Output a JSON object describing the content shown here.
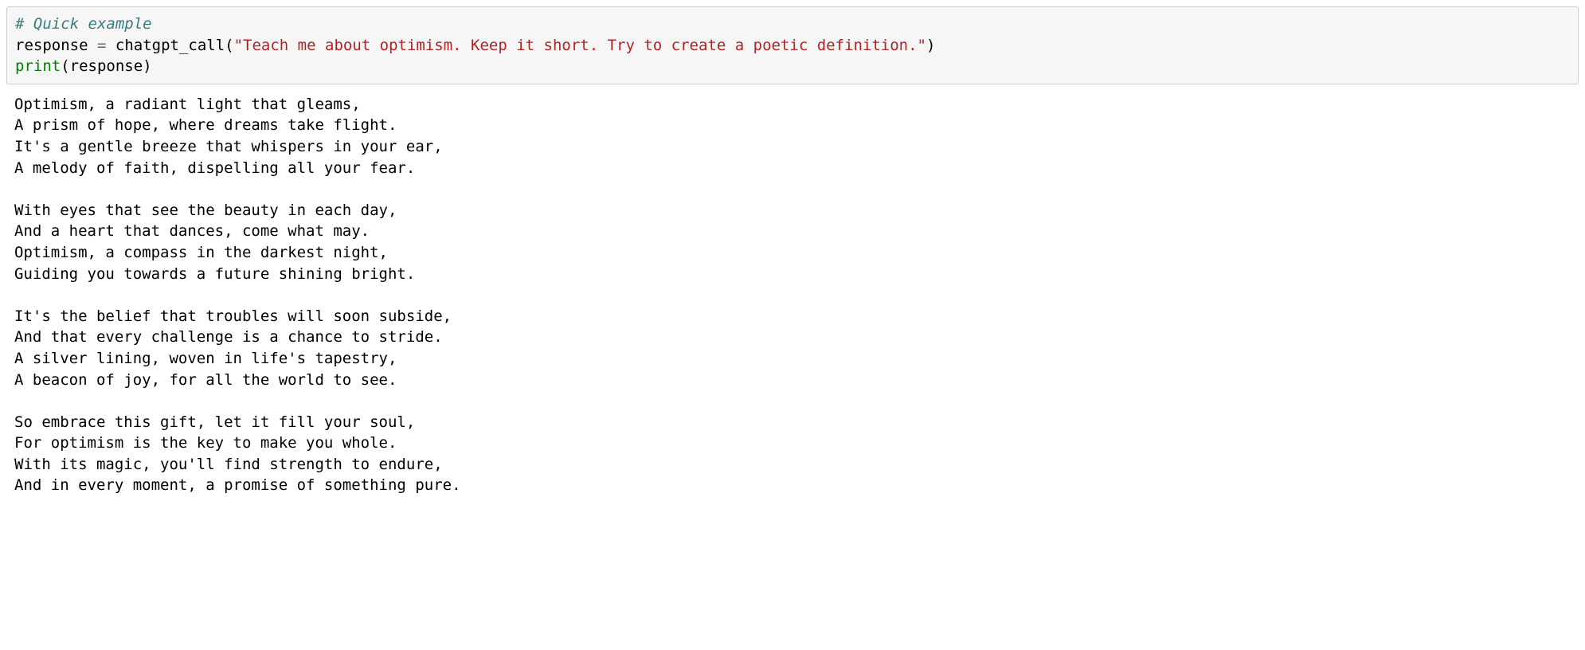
{
  "code": {
    "comment": "# Quick example",
    "line2": {
      "var": "response",
      "eq": "=",
      "func": "chatgpt_call",
      "lparen": "(",
      "arg": "\"Teach me about optimism. Keep it short. Try to create a poetic definition.\"",
      "rparen": ")"
    },
    "line3": {
      "builtin": "print",
      "lparen": "(",
      "arg": "response",
      "rparen": ")"
    }
  },
  "output": "Optimism, a radiant light that gleams,\nA prism of hope, where dreams take flight.\nIt's a gentle breeze that whispers in your ear,\nA melody of faith, dispelling all your fear.\n\nWith eyes that see the beauty in each day,\nAnd a heart that dances, come what may.\nOptimism, a compass in the darkest night,\nGuiding you towards a future shining bright.\n\nIt's the belief that troubles will soon subside,\nAnd that every challenge is a chance to stride.\nA silver lining, woven in life's tapestry,\nA beacon of joy, for all the world to see.\n\nSo embrace this gift, let it fill your soul,\nFor optimism is the key to make you whole.\nWith its magic, you'll find strength to endure,\nAnd in every moment, a promise of something pure."
}
